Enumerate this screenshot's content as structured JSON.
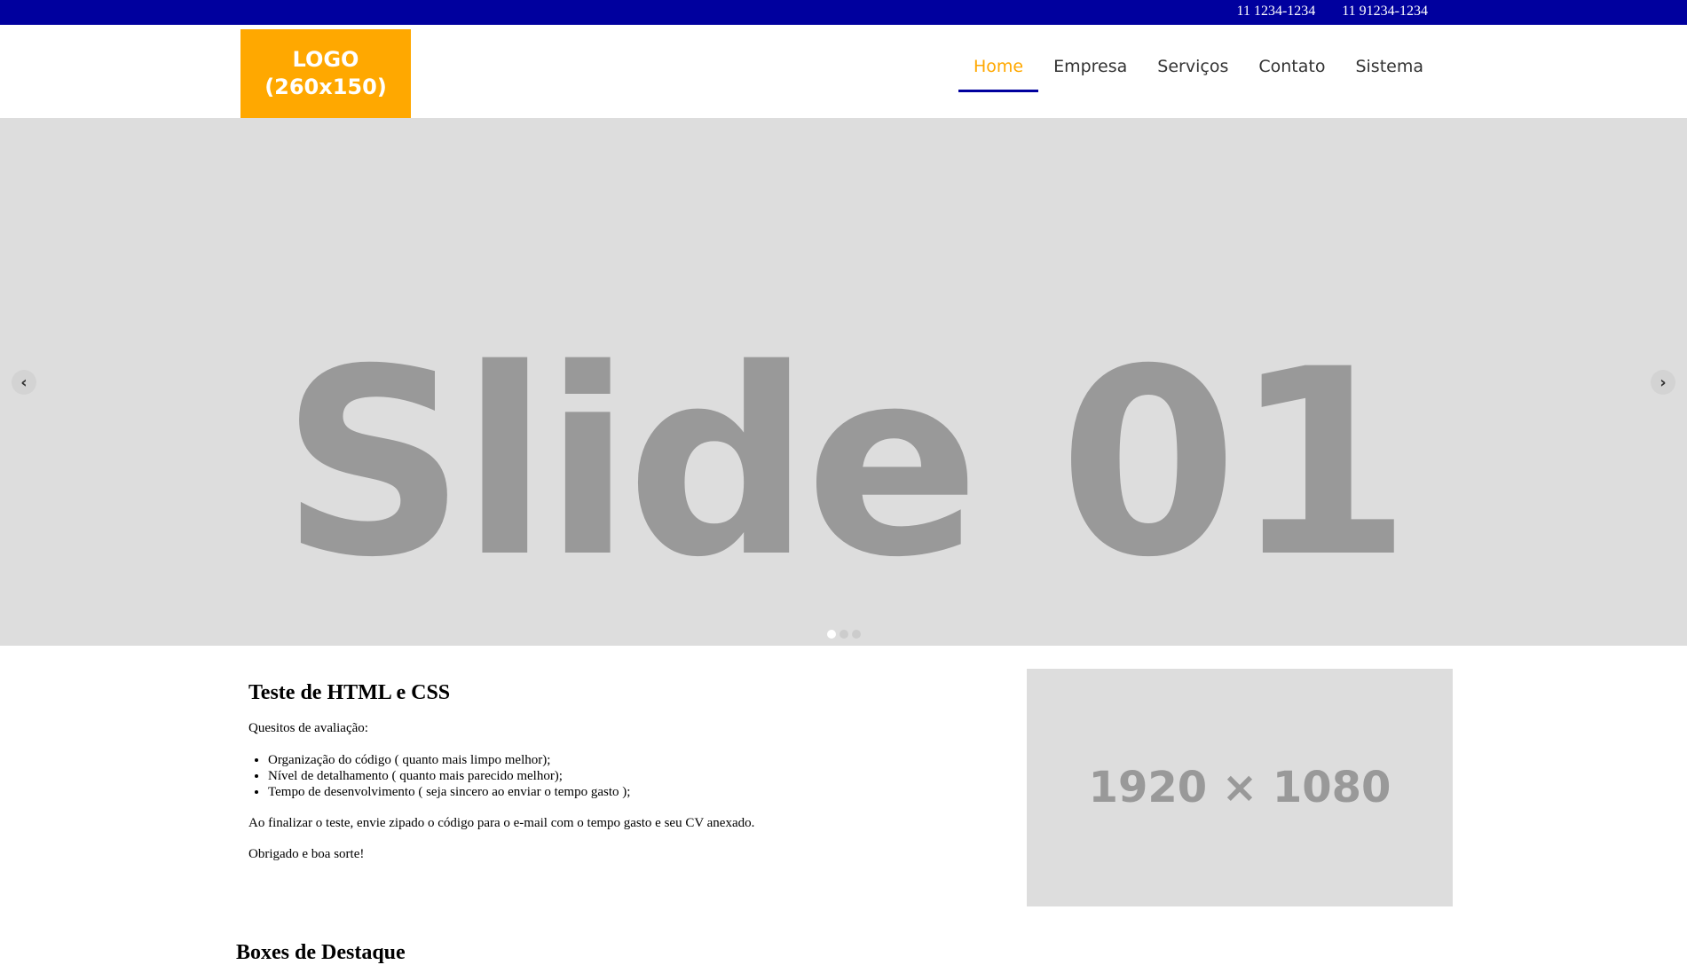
{
  "topbar": {
    "phone1": "11 1234-1234",
    "phone2": "11 91234-1234"
  },
  "logo": {
    "line1": "LOGO",
    "line2": "(260x150)"
  },
  "nav": {
    "items": [
      {
        "label": "Home"
      },
      {
        "label": "Empresa"
      },
      {
        "label": "Serviços"
      },
      {
        "label": "Contato"
      },
      {
        "label": "Sistema"
      }
    ]
  },
  "slider": {
    "text": "Slide 01",
    "prev": "‹",
    "next": "›",
    "active_dot": 1,
    "dot_count": 3
  },
  "content": {
    "title": "Teste de HTML e CSS",
    "intro": "Quesitos de avaliação:",
    "items": [
      "Organização do código ( quanto mais limpo melhor);",
      "Nível de detalhamento ( quanto mais parecido melhor);",
      "Tempo de desenvolvimento ( seja sincero ao enviar o tempo gasto );"
    ],
    "finish": "Ao finalizar o teste, envie zipado o código para o e-mail com o tempo gasto e seu CV anexado.",
    "thanks": "Obrigado e boa sorte!",
    "image_placeholder": "1920 × 1080"
  },
  "boxes": {
    "title": "Boxes de Destaque"
  },
  "colors": {
    "topbar": "#00009e",
    "logo": "#ffa800",
    "nav_active": "#ffa800",
    "slider_bg": "#dddddd"
  }
}
